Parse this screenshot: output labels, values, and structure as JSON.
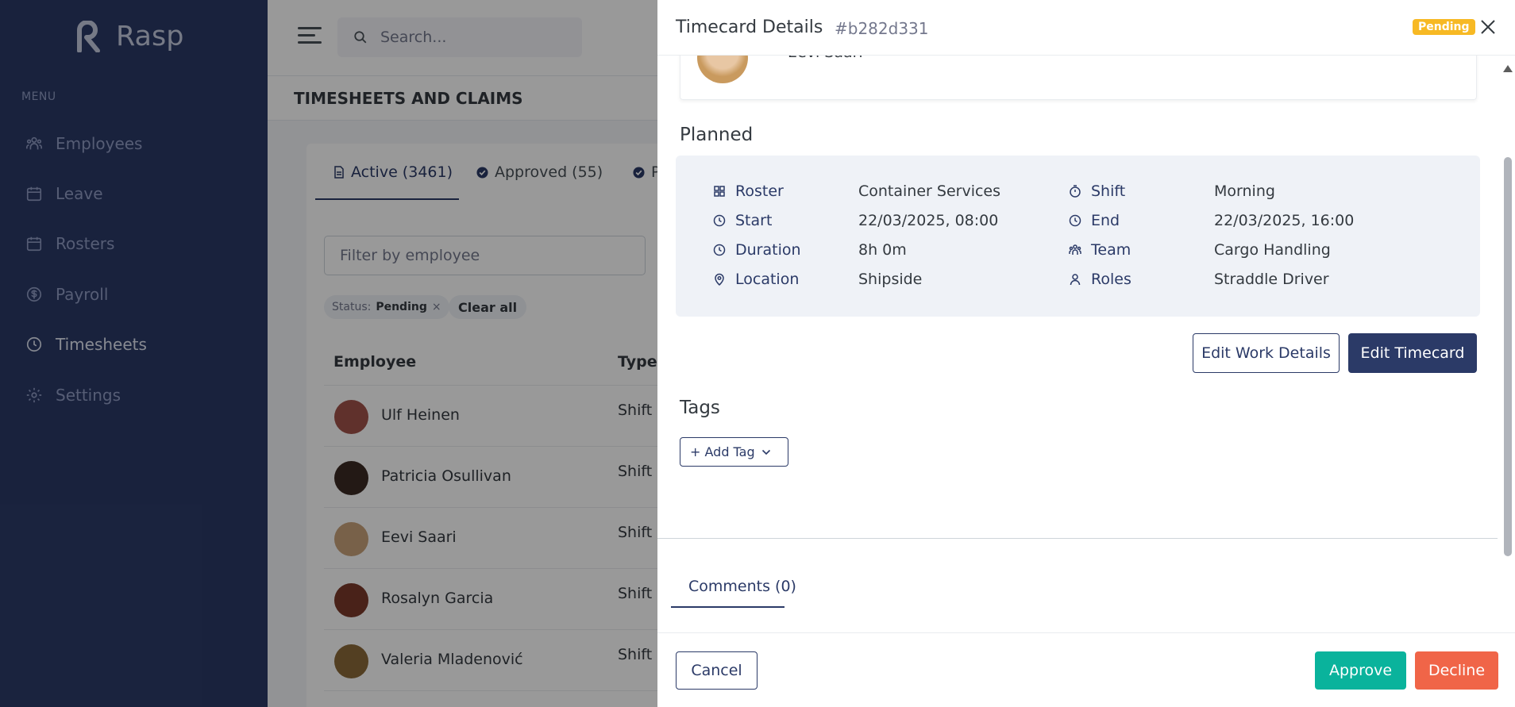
{
  "app": {
    "name": "Rasp"
  },
  "sidebar": {
    "menu_label": "MENU",
    "items": [
      {
        "label": "Employees",
        "icon": "users-icon"
      },
      {
        "label": "Leave",
        "icon": "calendar-icon"
      },
      {
        "label": "Rosters",
        "icon": "calendar-icon"
      },
      {
        "label": "Payroll",
        "icon": "dollar-circle-icon"
      },
      {
        "label": "Timesheets",
        "icon": "clock-icon",
        "active": true
      },
      {
        "label": "Settings",
        "icon": "gear-icon"
      }
    ]
  },
  "topbar": {
    "search_placeholder": "Search..."
  },
  "page": {
    "title": "TIMESHEETS AND CLAIMS"
  },
  "tabs": [
    {
      "label": "Active (3461)"
    },
    {
      "label": "Approved (55)"
    },
    {
      "label": "P"
    }
  ],
  "filter": {
    "placeholder": "Filter by employee"
  },
  "chip": {
    "key": "Status:",
    "value": "Pending",
    "remove": "×"
  },
  "clear_all": "Clear all",
  "table": {
    "headers": [
      "Employee",
      "Type"
    ],
    "rows": [
      {
        "name": "Ulf Heinen",
        "type": "Shift"
      },
      {
        "name": "Patricia Osullivan",
        "type": "Shift"
      },
      {
        "name": "Eevi Saari",
        "type": "Shift"
      },
      {
        "name": "Rosalyn Garcia",
        "type": "Shift"
      },
      {
        "name": "Valeria Mladenović",
        "type": "Shift"
      }
    ]
  },
  "drawer": {
    "title": "Timecard Details",
    "id": "#b282d331",
    "status": "Pending",
    "employee_name": "Eevi Saari",
    "planned": {
      "title": "Planned",
      "fields": [
        {
          "label": "Roster",
          "value": "Container Services",
          "icon": "grid-icon"
        },
        {
          "label": "Shift",
          "value": "Morning",
          "icon": "stopwatch-icon"
        },
        {
          "label": "Start",
          "value": "22/03/2025, 08:00",
          "icon": "clock-icon"
        },
        {
          "label": "End",
          "value": "22/03/2025, 16:00",
          "icon": "clock-icon"
        },
        {
          "label": "Duration",
          "value": "8h 0m",
          "icon": "clock-icon"
        },
        {
          "label": "Team",
          "value": "Cargo Handling",
          "icon": "team-icon"
        },
        {
          "label": "Location",
          "value": "Shipside",
          "icon": "map-pin-icon"
        },
        {
          "label": "Roles",
          "value": "Straddle Driver",
          "icon": "user-icon"
        }
      ]
    },
    "edit_work_details": "Edit Work Details",
    "edit_timecard": "Edit Timecard",
    "tags": {
      "title": "Tags",
      "add_label": "+ Add Tag"
    },
    "comments_tab": "Comments (0)",
    "cancel": "Cancel",
    "approve": "Approve",
    "decline": "Decline"
  },
  "colors": {
    "sidebar_bg": "#2b3a67",
    "primary": "#2b3a67",
    "approve": "#0ab39c",
    "decline": "#f06548",
    "pending": "#f7b924"
  }
}
